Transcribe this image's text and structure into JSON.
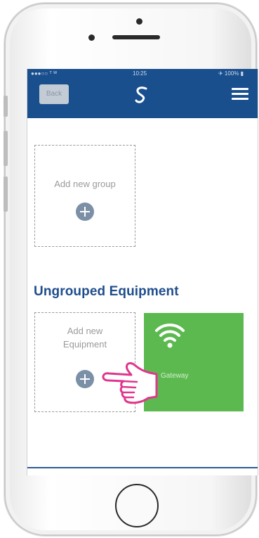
{
  "device": {
    "type": "smartphone"
  },
  "status_bar": {
    "carrier": "●●●○○ ᵀ ᵂ",
    "time": "10:25",
    "battery": "✈ 100% ▮"
  },
  "nav": {
    "back_label": "Back",
    "logo_icon": "swirl-logo-icon",
    "menu_icon": "hamburger-menu-icon"
  },
  "groups": {
    "add_group_label": "Add new group"
  },
  "ungrouped": {
    "title": "Ungrouped Equipment",
    "add_equipment_label_line1": "Add new",
    "add_equipment_label_line2": "Equipment",
    "gateway": {
      "label": "Gateway",
      "icon": "wifi-icon",
      "color": "#5cb94f"
    }
  },
  "colors": {
    "navbar": "#1a4f8e",
    "title": "#1f4d8c",
    "plus_circle": "#7b8fa6",
    "hand_outline": "#e0368c"
  }
}
